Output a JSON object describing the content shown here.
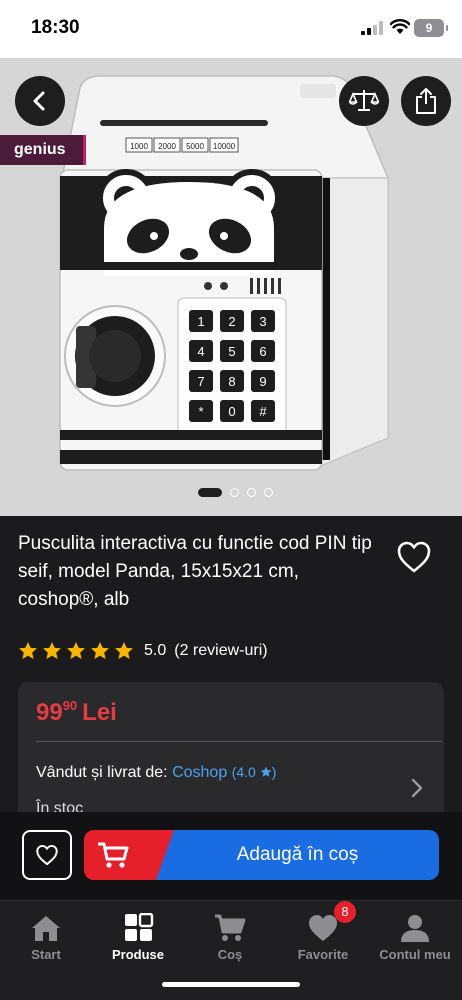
{
  "status_bar": {
    "time": "18:30",
    "battery": "9"
  },
  "hero": {
    "badge": "genius",
    "banknotes": [
      "1000",
      "2000",
      "5000",
      "10000"
    ],
    "keypad": [
      "1",
      "2",
      "3",
      "4",
      "5",
      "6",
      "7",
      "8",
      "9",
      "*",
      "0",
      "#"
    ],
    "carousel": {
      "total": 4,
      "active": 1
    }
  },
  "product": {
    "title": "Pusculita interactiva cu functie cod PIN tip seif, model Panda, 15x15x21 cm, coshop®, alb",
    "rating": {
      "stars": 5,
      "score": "5.0",
      "reviews": "(2 review-uri)"
    }
  },
  "offer": {
    "price_int": "99",
    "price_dec": "90",
    "currency": "Lei",
    "seller_label": "Vândut și livrat de:",
    "seller_name": "Coshop",
    "seller_rating": "(4.0",
    "stock": "În stoc"
  },
  "actions": {
    "add_to_cart": "Adaugă în coș"
  },
  "tabs": [
    {
      "label": "Start",
      "icon": "home-icon"
    },
    {
      "label": "Produse",
      "icon": "grid-icon"
    },
    {
      "label": "Coș",
      "icon": "cart-icon"
    },
    {
      "label": "Favorite",
      "icon": "heart-icon",
      "badge": "8"
    },
    {
      "label": "Contul meu",
      "icon": "user-icon"
    }
  ],
  "colors": {
    "price": "#e73b42",
    "link": "#4aa3f0",
    "cta_blue": "#1a6ce3",
    "cta_red": "#e5202b",
    "star": "#f7b500"
  }
}
